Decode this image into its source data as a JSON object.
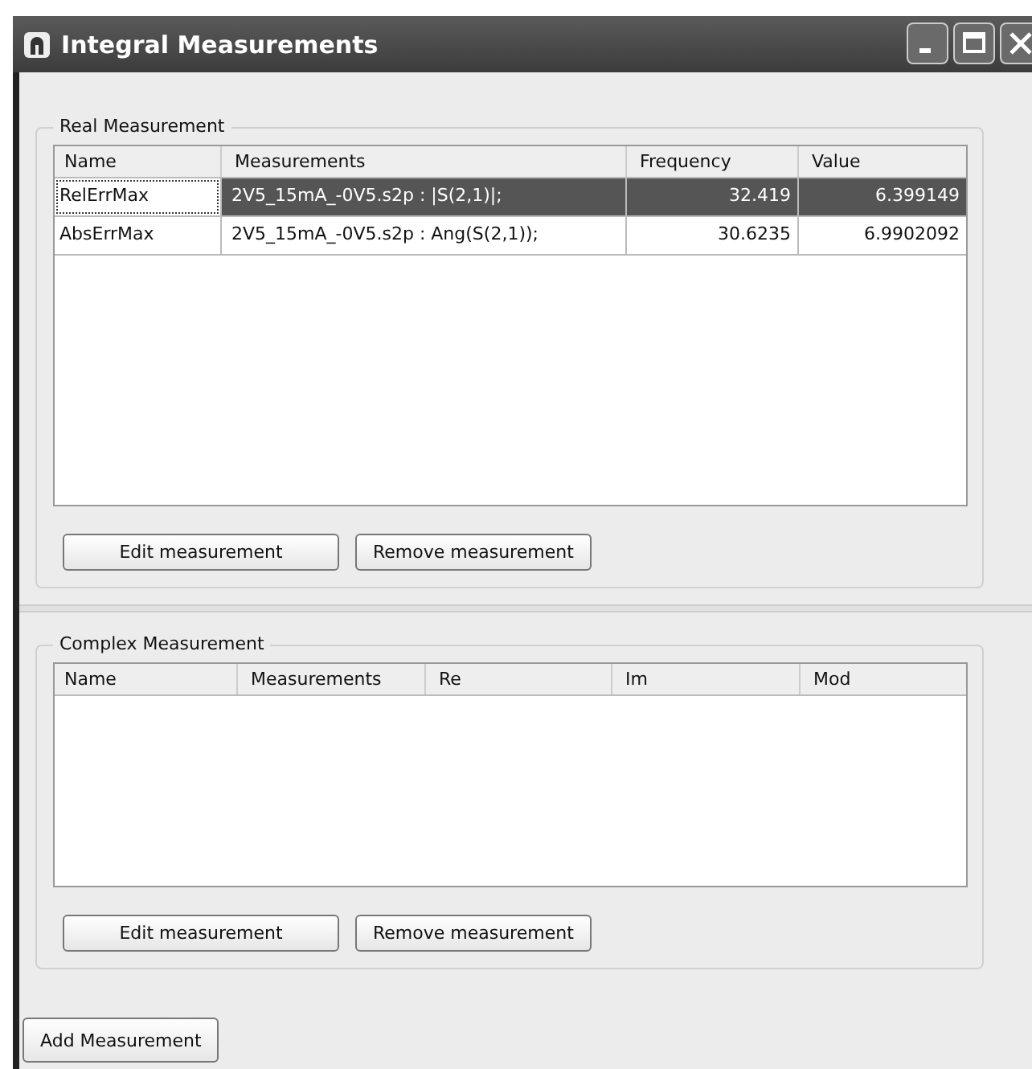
{
  "window": {
    "title": "Integral Measurements"
  },
  "real_measurement": {
    "title": "Real Measurement",
    "table": {
      "columns": [
        "Name",
        "Measurements",
        "Frequency",
        "Value"
      ],
      "rows": [
        {
          "selected": true,
          "cells": [
            "RelErrMax",
            "2V5_15mA_-0V5.s2p : |S(2,1)|;",
            "32.419",
            "6.399149"
          ]
        },
        {
          "selected": false,
          "cells": [
            "AbsErrMax",
            "2V5_15mA_-0V5.s2p : Ang(S(2,1));",
            "30.6235",
            "6.9902092"
          ]
        }
      ]
    },
    "buttons": [
      "Edit measurement",
      "Remove measurement"
    ]
  },
  "complex_measurement": {
    "title": "Complex Measurement",
    "table": {
      "columns": [
        "Name",
        "Measurements",
        "Re",
        "Im",
        "Mod"
      ]
    },
    "buttons": [
      "Edit measurement",
      "Remove measurement"
    ]
  },
  "add_button": "Add Measurement"
}
